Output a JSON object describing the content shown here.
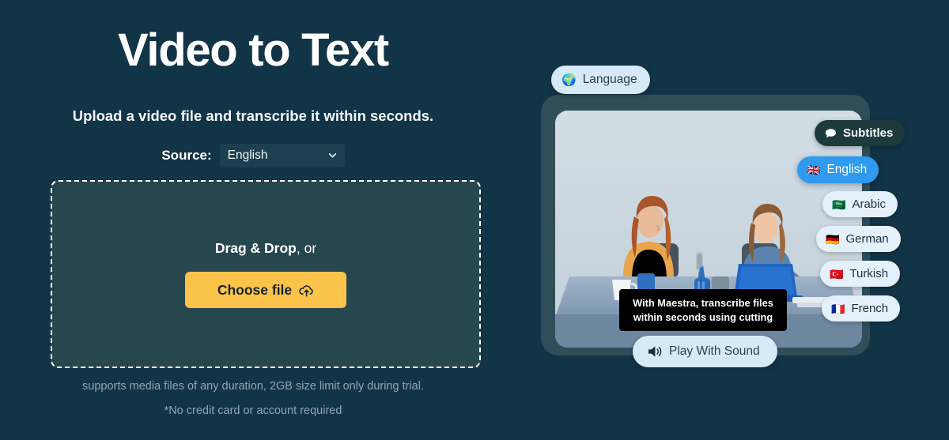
{
  "theme": {
    "background": "#123447",
    "dropzone_bg": "#27474f",
    "accent_button": "#fbc34a",
    "active_pill": "#2e9bf0",
    "dark_pill": "#1d3a3c",
    "light_pill": "#d6e9f7"
  },
  "hero": {
    "title": "Video to Text",
    "subtitle": "Upload a video file and transcribe it within seconds."
  },
  "source": {
    "label": "Source:",
    "selected": "English",
    "options": [
      "English"
    ],
    "chevron_icon": "chevron-down-icon"
  },
  "dropzone": {
    "drag_bold": "Drag & Drop",
    "drag_rest": ", or",
    "button_label": "Choose file",
    "button_icon": "cloud-upload-icon"
  },
  "notes": {
    "line1": "supports media files of any duration, 2GB size limit only during trial.",
    "line2": "*No credit card or account required"
  },
  "preview": {
    "language_badge": {
      "label": "Language",
      "icon": "globe-icon",
      "glyph": "🌍"
    },
    "subtitles_badge": {
      "label": "Subtitles",
      "icon": "speech-bubble-icon"
    },
    "caption": {
      "line1": "With Maestra, transcribe files",
      "line2": "within seconds using cutting"
    },
    "play_button": {
      "label": "Play With Sound",
      "icon": "speaker-icon"
    },
    "languages": [
      {
        "label": "English",
        "flag": "🇬🇧",
        "active": true
      },
      {
        "label": "Arabic",
        "flag": "🇸🇦",
        "active": false
      },
      {
        "label": "German",
        "flag": "🇩🇪",
        "active": false
      },
      {
        "label": "Turkish",
        "flag": "🇹🇷",
        "active": false
      },
      {
        "label": "French",
        "flag": "🇫🇷",
        "active": false
      }
    ]
  }
}
